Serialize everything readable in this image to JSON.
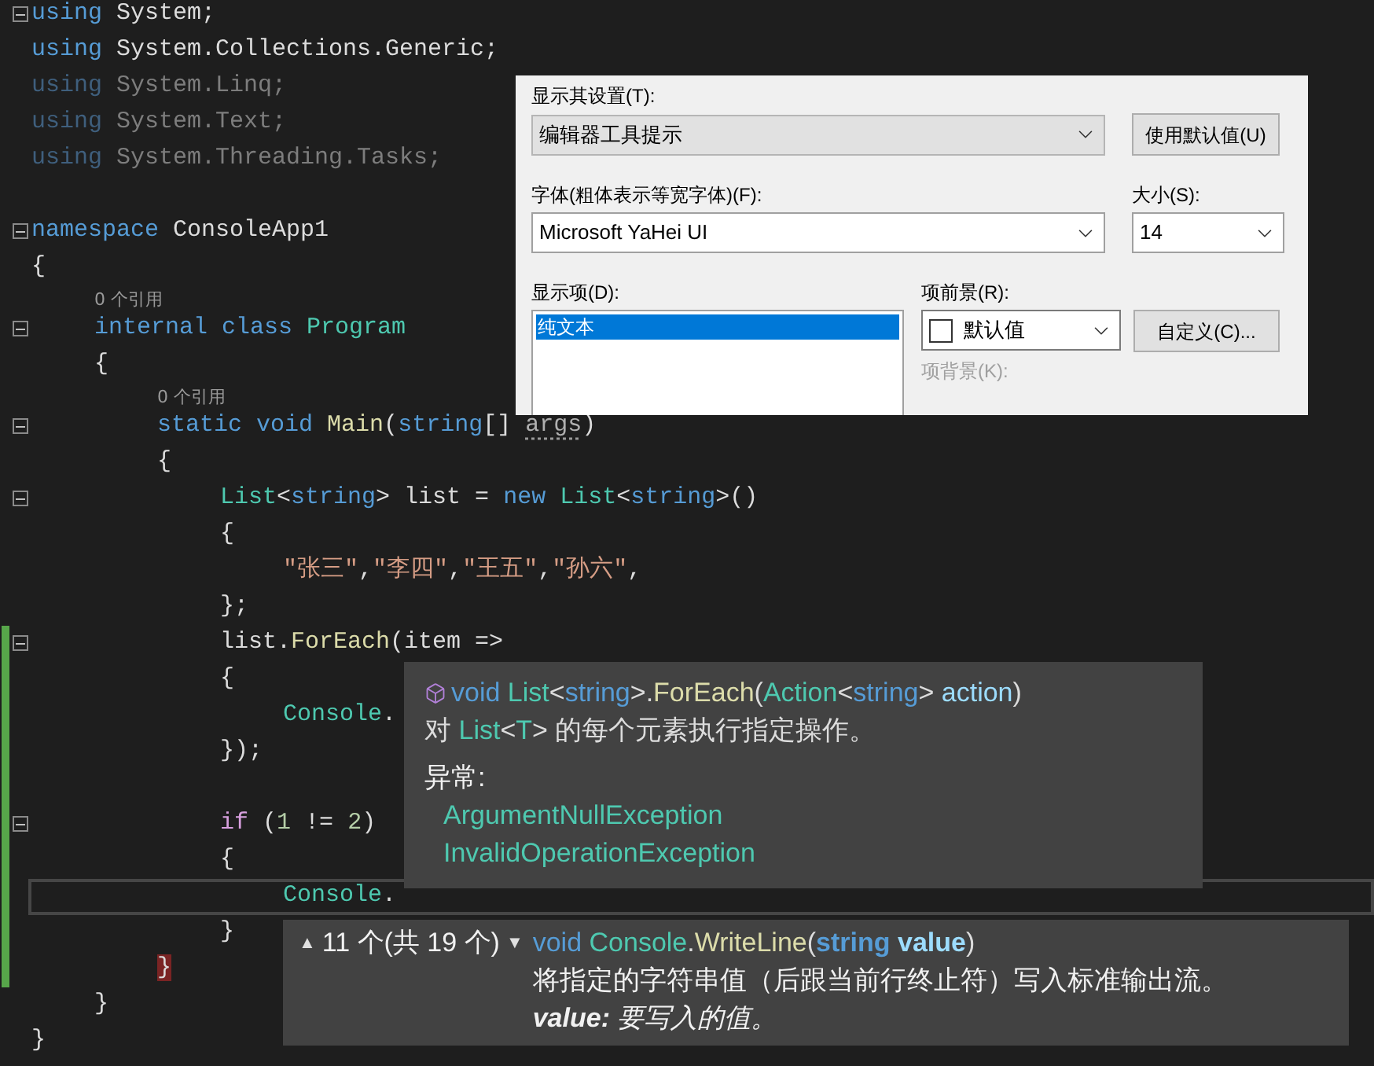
{
  "editor": {
    "lines": [
      {
        "kind": "code",
        "foldable": true,
        "changed": false,
        "current": false,
        "tokens": [
          {
            "text": "using",
            "kind": "keyword"
          },
          {
            "text": " System;",
            "kind": "plain"
          }
        ]
      },
      {
        "kind": "code",
        "foldable": false,
        "changed": false,
        "current": false,
        "tokens": [
          {
            "text": "using",
            "kind": "keyword"
          },
          {
            "text": " System.Collections.Generic;",
            "kind": "plain"
          }
        ]
      },
      {
        "kind": "code",
        "foldable": false,
        "changed": false,
        "current": false,
        "tokens": [
          {
            "text": "using",
            "kind": "dim-keyword"
          },
          {
            "text": " System.Linq;",
            "kind": "dim"
          }
        ]
      },
      {
        "kind": "code",
        "foldable": false,
        "changed": false,
        "current": false,
        "tokens": [
          {
            "text": "using",
            "kind": "dim-keyword"
          },
          {
            "text": " System.Text;",
            "kind": "dim"
          }
        ]
      },
      {
        "kind": "code",
        "foldable": false,
        "changed": false,
        "current": false,
        "tokens": [
          {
            "text": "using",
            "kind": "dim-keyword"
          },
          {
            "text": " System.Threading.Tasks;",
            "kind": "dim"
          }
        ]
      },
      {
        "kind": "blank",
        "foldable": false,
        "changed": false,
        "current": false
      },
      {
        "kind": "code",
        "foldable": true,
        "changed": false,
        "current": false,
        "tokens": [
          {
            "text": "namespace",
            "kind": "keyword"
          },
          {
            "text": " ConsoleApp1",
            "kind": "plain"
          }
        ]
      },
      {
        "kind": "code",
        "foldable": false,
        "changed": false,
        "current": false,
        "tokens": [
          {
            "text": "{",
            "kind": "plain"
          }
        ],
        "children": [
          {
            "kind": "codelens",
            "text": "0 个引用"
          },
          {
            "kind": "code",
            "foldable": true,
            "changed": false,
            "current": false,
            "tokens": [
              {
                "text": "internal class",
                "kind": "keyword"
              },
              {
                "text": " Program",
                "kind": "type"
              }
            ]
          },
          {
            "kind": "code",
            "foldable": false,
            "changed": false,
            "current": false,
            "tokens": [
              {
                "text": "{",
                "kind": "plain"
              }
            ],
            "children": [
              {
                "kind": "codelens",
                "text": "0 个引用"
              },
              {
                "kind": "code",
                "foldable": true,
                "changed": false,
                "current": false,
                "tokens": [
                  {
                    "text": "static void",
                    "kind": "keyword"
                  },
                  {
                    "text": " Main",
                    "kind": "method"
                  },
                  {
                    "text": "(",
                    "kind": "plain"
                  },
                  {
                    "text": "string",
                    "kind": "keyword"
                  },
                  {
                    "text": "[] ",
                    "kind": "plain"
                  },
                  {
                    "text": "args",
                    "kind": "unused"
                  },
                  {
                    "text": ")",
                    "kind": "plain"
                  }
                ]
              },
              {
                "kind": "code",
                "foldable": false,
                "changed": false,
                "current": false,
                "tokens": [
                  {
                    "text": "{",
                    "kind": "plain"
                  }
                ],
                "children": [
                  {
                    "kind": "code",
                    "foldable": true,
                    "changed": false,
                    "current": false,
                    "tokens": [
                      {
                        "text": "List",
                        "kind": "type"
                      },
                      {
                        "text": "<",
                        "kind": "plain"
                      },
                      {
                        "text": "string",
                        "kind": "keyword"
                      },
                      {
                        "text": "> list = ",
                        "kind": "plain"
                      },
                      {
                        "text": "new",
                        "kind": "keyword"
                      },
                      {
                        "text": " List",
                        "kind": "type"
                      },
                      {
                        "text": "<",
                        "kind": "plain"
                      },
                      {
                        "text": "string",
                        "kind": "keyword"
                      },
                      {
                        "text": ">()",
                        "kind": "plain"
                      }
                    ]
                  },
                  {
                    "kind": "code",
                    "foldable": false,
                    "changed": false,
                    "current": false,
                    "tokens": [
                      {
                        "text": "{",
                        "kind": "plain"
                      }
                    ],
                    "children": [
                      {
                        "kind": "code",
                        "foldable": false,
                        "changed": false,
                        "current": false,
                        "tokens": [
                          {
                            "text": "\"张三\"",
                            "kind": "string"
                          },
                          {
                            "text": ",",
                            "kind": "plain"
                          },
                          {
                            "text": "\"李四\"",
                            "kind": "string"
                          },
                          {
                            "text": ",",
                            "kind": "plain"
                          },
                          {
                            "text": "\"王五\"",
                            "kind": "string"
                          },
                          {
                            "text": ",",
                            "kind": "plain"
                          },
                          {
                            "text": "\"孙六\"",
                            "kind": "string"
                          },
                          {
                            "text": ",",
                            "kind": "plain"
                          }
                        ]
                      }
                    ]
                  },
                  {
                    "kind": "code",
                    "foldable": false,
                    "changed": false,
                    "current": false,
                    "tokens": [
                      {
                        "text": "};",
                        "kind": "plain"
                      }
                    ]
                  },
                  {
                    "kind": "code",
                    "foldable": true,
                    "changed": true,
                    "current": false,
                    "tokens": [
                      {
                        "text": "list.",
                        "kind": "plain"
                      },
                      {
                        "text": "ForEach",
                        "kind": "method"
                      },
                      {
                        "text": "(item =>",
                        "kind": "plain"
                      }
                    ]
                  },
                  {
                    "kind": "code",
                    "foldable": false,
                    "changed": true,
                    "current": false,
                    "tokens": [
                      {
                        "text": "{",
                        "kind": "plain"
                      }
                    ],
                    "children": [
                      {
                        "kind": "code",
                        "foldable": false,
                        "changed": true,
                        "current": false,
                        "tokens": [
                          {
                            "text": "Console",
                            "kind": "type"
                          },
                          {
                            "text": ".",
                            "kind": "plain"
                          }
                        ]
                      }
                    ]
                  },
                  {
                    "kind": "code",
                    "foldable": false,
                    "changed": true,
                    "current": false,
                    "tokens": [
                      {
                        "text": "});",
                        "kind": "plain"
                      }
                    ]
                  },
                  {
                    "kind": "blank",
                    "foldable": false,
                    "changed": true,
                    "current": false
                  },
                  {
                    "kind": "code",
                    "foldable": true,
                    "changed": true,
                    "current": false,
                    "tokens": [
                      {
                        "text": "if",
                        "kind": "control"
                      },
                      {
                        "text": " (",
                        "kind": "plain"
                      },
                      {
                        "text": "1",
                        "kind": "number"
                      },
                      {
                        "text": " != ",
                        "kind": "plain"
                      },
                      {
                        "text": "2",
                        "kind": "number"
                      },
                      {
                        "text": ")",
                        "kind": "plain"
                      }
                    ]
                  },
                  {
                    "kind": "code",
                    "foldable": false,
                    "changed": true,
                    "current": false,
                    "tokens": [
                      {
                        "text": "{",
                        "kind": "plain"
                      }
                    ],
                    "children": [
                      {
                        "kind": "code",
                        "foldable": false,
                        "changed": true,
                        "current": true,
                        "tokens": [
                          {
                            "text": "Console",
                            "kind": "type"
                          },
                          {
                            "text": ".",
                            "kind": "plain"
                          }
                        ]
                      }
                    ]
                  },
                  {
                    "kind": "code",
                    "foldable": false,
                    "changed": true,
                    "current": false,
                    "tokens": [
                      {
                        "text": "}",
                        "kind": "plain"
                      }
                    ]
                  }
                ]
              },
              {
                "kind": "code",
                "foldable": false,
                "changed": true,
                "current": false,
                "tokens": [
                  {
                    "text": "}",
                    "kind": "brace-match"
                  }
                ]
              }
            ]
          },
          {
            "kind": "code",
            "foldable": false,
            "changed": false,
            "current": false,
            "tokens": [
              {
                "text": "}",
                "kind": "plain"
              }
            ]
          }
        ]
      },
      {
        "kind": "code",
        "foldable": false,
        "changed": false,
        "current": false,
        "tokens": [
          {
            "text": "}",
            "kind": "plain"
          }
        ]
      }
    ]
  },
  "options_dialog": {
    "setting_label": "显示其设置(T):",
    "setting_select": "编辑器工具提示",
    "default_button": "使用默认值(U)",
    "font_label": "字体(粗体表示等宽字体)(F):",
    "font_select": "Microsoft YaHei UI",
    "size_label": "大小(S):",
    "size_select": "14",
    "items_label": "显示项(D):",
    "items": [
      {
        "label": "纯文本",
        "selected": true
      }
    ],
    "foreground_label": "项前景(R):",
    "foreground_select": "默认值",
    "custom_button": "自定义(C)...",
    "background_label": "项背景(K):"
  },
  "quick_info": {
    "signature": [
      {
        "text": "void",
        "kind": "keyword"
      },
      {
        "text": " List",
        "kind": "type"
      },
      {
        "text": "<",
        "kind": "plain"
      },
      {
        "text": "string",
        "kind": "keyword"
      },
      {
        "text": ">.",
        "kind": "plain"
      },
      {
        "text": "ForEach",
        "kind": "method"
      },
      {
        "text": "(",
        "kind": "plain"
      },
      {
        "text": "Action",
        "kind": "type"
      },
      {
        "text": "<",
        "kind": "plain"
      },
      {
        "text": "string",
        "kind": "keyword"
      },
      {
        "text": "> ",
        "kind": "plain"
      },
      {
        "text": "action",
        "kind": "param"
      },
      {
        "text": ")",
        "kind": "plain"
      }
    ],
    "description": [
      {
        "text": "对 ",
        "kind": "plain"
      },
      {
        "text": "List",
        "kind": "type"
      },
      {
        "text": "<",
        "kind": "plain"
      },
      {
        "text": "T",
        "kind": "type"
      },
      {
        "text": ">",
        "kind": "plain"
      },
      {
        "text": " 的每个元素执行指定操作。",
        "kind": "plain"
      }
    ],
    "exceptions_heading": "异常:",
    "exceptions": [
      "ArgumentNullException",
      "InvalidOperationException"
    ]
  },
  "signature_help": {
    "previous": "▲",
    "counter": "11 个(共 19 个)",
    "next": "▼",
    "signature": [
      {
        "text": "void",
        "kind": "keyword"
      },
      {
        "text": " Console",
        "kind": "type"
      },
      {
        "text": ".",
        "kind": "plain"
      },
      {
        "text": "WriteLine",
        "kind": "method"
      },
      {
        "text": "(",
        "kind": "plain"
      },
      {
        "text": "string",
        "kind": "keyword-bold"
      },
      {
        "text": " value",
        "kind": "param-bold"
      },
      {
        "text": ")",
        "kind": "plain"
      }
    ],
    "description": "将指定的字符串值（后跟当前行终止符）写入标准输出流。",
    "parameter_doc": "**value:** 要写入的值。"
  }
}
